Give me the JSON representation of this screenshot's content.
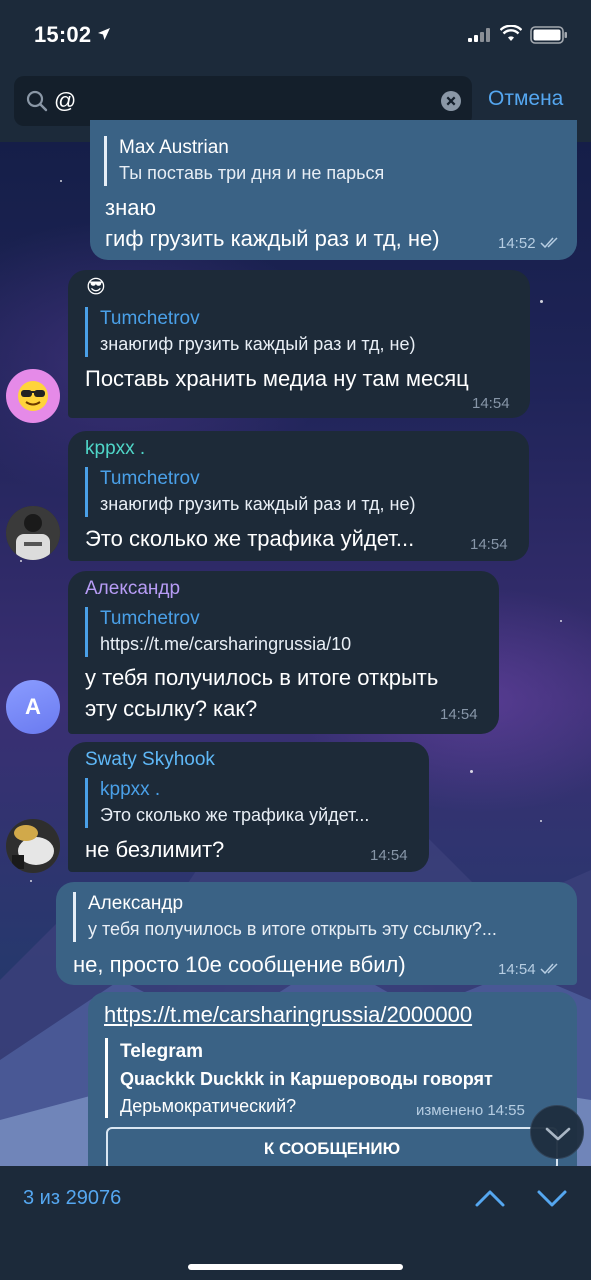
{
  "status_bar": {
    "time": "15:02"
  },
  "search": {
    "query": "@",
    "cancel_label": "Отмена"
  },
  "messages": [
    {
      "reply_name": "Max Austrian",
      "reply_text": "Ты поставь три дня и не парься",
      "text_line1": "знаю",
      "text_line2": "гиф грузить каждый раз и тд, не)",
      "time": "14:52"
    },
    {
      "sender": "😎",
      "reply_name": "Tumchetrov",
      "reply_text": "знаюгиф грузить каждый раз и тд, не)",
      "text": "Поставь хранить медиа ну там месяц",
      "time": "14:54"
    },
    {
      "sender": "kppxx .",
      "reply_name": "Tumchetrov",
      "reply_text": "знаюгиф грузить каждый раз и тд, не)",
      "text": "Это сколько же трафика уйдет...",
      "time": "14:54"
    },
    {
      "sender": "Александр",
      "reply_name": "Tumchetrov",
      "reply_text": "https://t.me/carsharingrussia/10",
      "text_line1": "у тебя получилось в итоге открыть",
      "text_line2": "эту ссылку? как?",
      "time": "14:54",
      "avatar_letter": "A"
    },
    {
      "sender": "Swaty Skyhook",
      "reply_name": "kppxx .",
      "reply_text": "Это сколько же трафика уйдет...",
      "text": "не безлимит?",
      "time": "14:54"
    },
    {
      "reply_name": "Александр",
      "reply_text": "у тебя получилось в итоге открыть эту ссылку?...",
      "text": "не, просто 10е сообщение вбил)",
      "time": "14:54"
    },
    {
      "link": "https://t.me/carsharingrussia/2000000",
      "preview_site": "Telegram",
      "preview_title": "Quackkk Duckkk in Каршероводы говорят",
      "preview_desc": "Дерьмократический?",
      "edited_time": "изменено 14:55",
      "button_label": "К СООБЩЕНИЮ"
    }
  ],
  "footer": {
    "counter": "3 из 29076"
  },
  "colors": {
    "accent": "#55a7f0",
    "bubble_in": "#1d2a38",
    "bubble_out": "#3a6285",
    "name_kppxx": "#4fd6c8",
    "name_alexandr": "#b79cf5",
    "name_swaty": "#5fb8f7"
  }
}
